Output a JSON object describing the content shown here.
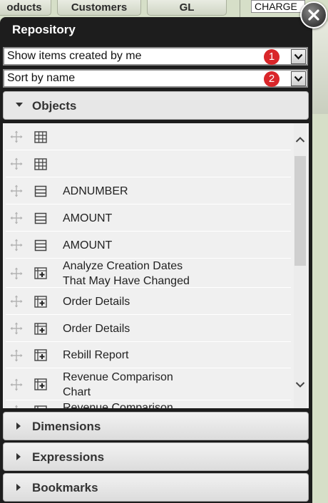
{
  "background": {
    "tabs": [
      "oducts",
      "Customers",
      "GL"
    ],
    "charge_label": "CHARGE"
  },
  "panel": {
    "title": "Repository"
  },
  "filters": {
    "show_items": {
      "value": "Show items created by me",
      "badge": "1"
    },
    "sort": {
      "value": "Sort by name",
      "badge": "2"
    }
  },
  "sections": {
    "objects": "Objects",
    "dimensions": "Dimensions",
    "expressions": "Expressions",
    "bookmarks": "Bookmarks"
  },
  "objects": [
    {
      "icon": "table-icon",
      "lines": [
        ""
      ]
    },
    {
      "icon": "table-icon",
      "lines": [
        ""
      ]
    },
    {
      "icon": "field-icon",
      "lines": [
        "ADNUMBER"
      ]
    },
    {
      "icon": "field-icon",
      "lines": [
        "AMOUNT"
      ]
    },
    {
      "icon": "field-icon",
      "lines": [
        "AMOUNT"
      ]
    },
    {
      "icon": "straight-table-icon",
      "lines": [
        "Analyze Creation Dates",
        "That May Have Changed"
      ]
    },
    {
      "icon": "straight-table-icon",
      "lines": [
        "Order Details"
      ]
    },
    {
      "icon": "straight-table-icon",
      "lines": [
        "Order Details"
      ]
    },
    {
      "icon": "straight-table-icon",
      "lines": [
        "Rebill Report"
      ]
    },
    {
      "icon": "straight-table-icon",
      "lines": [
        "Revenue Comparison",
        "Chart"
      ]
    },
    {
      "icon": "straight-table-icon",
      "lines": [
        "Revenue Comparison"
      ]
    }
  ],
  "colors": {
    "panel": "#1d1d1d",
    "badge": "#d9262a",
    "list_bg": "#f0f0f0"
  }
}
